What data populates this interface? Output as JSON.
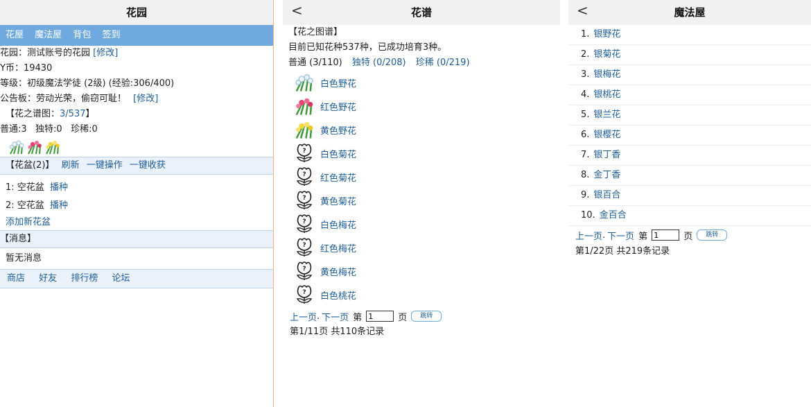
{
  "colors": {
    "link": "#1f5d99",
    "navbar": "#6fa9de",
    "section_bg": "#eaf1fb",
    "divider": "#f2b57c"
  },
  "garden": {
    "title": "花园",
    "nav": [
      "花屋",
      "魔法屋",
      "背包",
      "签到"
    ],
    "garden_label": "花园：测试账号的花园",
    "modify": "[修改]",
    "coins": "Y币：19430",
    "level": "等级：初级魔法学徒 (2级) (经验:306/400)",
    "notice_label": "公告板：劳动光荣，偷窃可耻！",
    "atlas_open": "【花之谱图：",
    "atlas_value": "3/537",
    "atlas_close": "】",
    "counts": "普通:3   独特:0   珍稀:0",
    "pots_title": "【花盆(2)】",
    "pot_actions": [
      "刷新",
      "一键操作",
      "一键收获"
    ],
    "pots": [
      {
        "label": "1: 空花盆",
        "action": "播种"
      },
      {
        "label": "2: 空花盆",
        "action": "播种"
      }
    ],
    "add_pot": "添加新花盆",
    "messages_title": "【消息】",
    "no_messages": "暂无消息",
    "footer": [
      "商店",
      "好友",
      "排行榜",
      "论坛"
    ]
  },
  "atlas": {
    "title": "花谱",
    "back": "<",
    "heading": "【花之图谱】",
    "known": "目前已知花种537种，已成功培育3种。",
    "tabs": [
      "普通 (3/110)",
      "独特 (0/208)",
      "珍稀 (0/219)"
    ],
    "flowers": [
      {
        "name": "白色野花",
        "icon": "white-wildflower-icon"
      },
      {
        "name": "红色野花",
        "icon": "red-wildflower-icon"
      },
      {
        "name": "黄色野花",
        "icon": "yellow-wildflower-icon"
      },
      {
        "name": "白色菊花",
        "icon": "unknown-flower-icon"
      },
      {
        "name": "红色菊花",
        "icon": "unknown-flower-icon"
      },
      {
        "name": "黄色菊花",
        "icon": "unknown-flower-icon"
      },
      {
        "name": "白色梅花",
        "icon": "unknown-flower-icon"
      },
      {
        "name": "红色梅花",
        "icon": "unknown-flower-icon"
      },
      {
        "name": "黄色梅花",
        "icon": "unknown-flower-icon"
      },
      {
        "name": "白色桃花",
        "icon": "unknown-flower-icon"
      }
    ],
    "pager": {
      "prev": "上一页",
      "next": "下一页",
      "page_label": "第",
      "page_value": "1",
      "page_unit": "页",
      "jump": "跳转"
    },
    "summary": "第1/11页 共110条记录"
  },
  "magic": {
    "title": "魔法屋",
    "back": "<",
    "items": [
      {
        "num": "1.",
        "name": "银野花"
      },
      {
        "num": "2.",
        "name": "银菊花"
      },
      {
        "num": "3.",
        "name": "银梅花"
      },
      {
        "num": "4.",
        "name": "银桃花"
      },
      {
        "num": "5.",
        "name": "银兰花"
      },
      {
        "num": "6.",
        "name": "银樱花"
      },
      {
        "num": "7.",
        "name": "银丁香"
      },
      {
        "num": "8.",
        "name": "金丁香"
      },
      {
        "num": "9.",
        "name": "银百合"
      },
      {
        "num": "10.",
        "name": "金百合"
      }
    ],
    "pager": {
      "prev": "上一页",
      "next": "下一页",
      "page_label": "第",
      "page_value": "1",
      "page_unit": "页",
      "jump": "跳转"
    },
    "summary": "第1/22页 共219条记录"
  }
}
